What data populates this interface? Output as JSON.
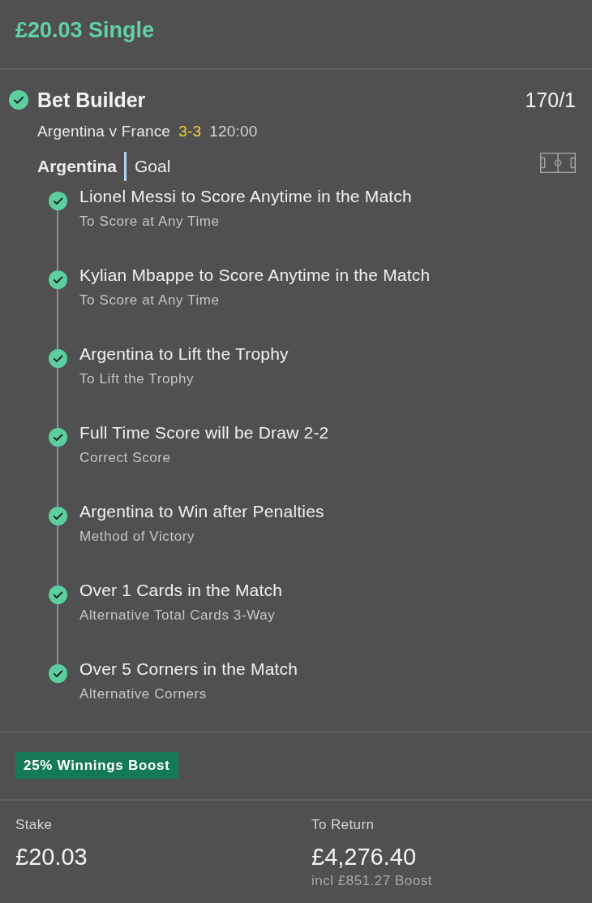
{
  "header": {
    "title": "£20.03 Single"
  },
  "bet": {
    "checked": true,
    "title": "Bet Builder",
    "odds": "170/1",
    "match": "Argentina v France",
    "score": "3-3",
    "clock": "120:00",
    "team": "Argentina",
    "market": "Goal"
  },
  "selections": [
    {
      "name": "Lionel Messi to Score Anytime in the Match",
      "market": "To Score at Any Time",
      "checked": true
    },
    {
      "name": "Kylian Mbappe to Score Anytime in the Match",
      "market": "To Score at Any Time",
      "checked": true
    },
    {
      "name": "Argentina to Lift the Trophy",
      "market": "To Lift the Trophy",
      "checked": true
    },
    {
      "name": "Full Time Score will be Draw 2-2",
      "market": "Correct Score",
      "checked": true
    },
    {
      "name": "Argentina to Win after Penalties",
      "market": "Method of Victory",
      "checked": true
    },
    {
      "name": "Over 1 Cards in the Match",
      "market": "Alternative Total Cards 3-Way",
      "checked": true
    },
    {
      "name": "Over 5 Corners in the Match",
      "market": "Alternative Corners",
      "checked": true
    }
  ],
  "boost": {
    "label": "25% Winnings Boost"
  },
  "summary": {
    "stake_label": "Stake",
    "stake": "£20.03",
    "return_label": "To Return",
    "return": "£4,276.40",
    "boost_note": "incl £851.27 Boost"
  }
}
